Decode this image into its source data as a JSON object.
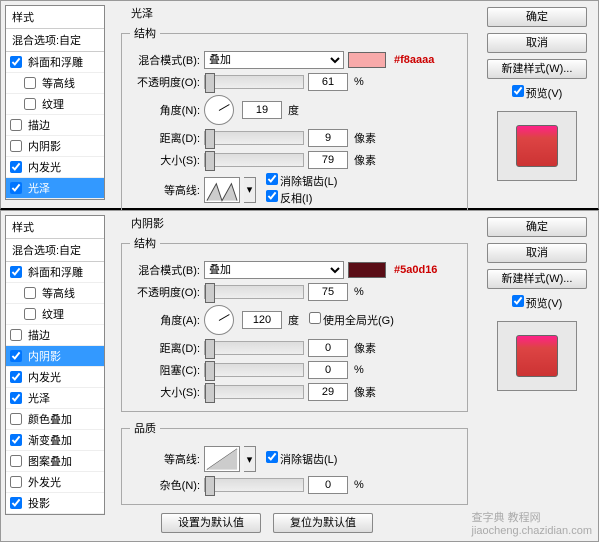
{
  "common": {
    "styles_header": "样式",
    "blend_options": "混合选项:自定",
    "ok": "确定",
    "cancel": "取消",
    "new_style": "新建样式(W)...",
    "preview": "预览(V)",
    "watermark": "查字典 教程网",
    "watermark_url": "jiaocheng.chazidian.com"
  },
  "p1": {
    "title": "光泽",
    "structure": "结构",
    "effects": {
      "bevel": "斜面和浮雕",
      "contour": "等高线",
      "texture": "纹理",
      "stroke": "描边",
      "inner_shadow": "内阴影",
      "inner_glow": "内发光",
      "satin": "光泽"
    },
    "fields": {
      "blend_mode_l": "混合模式(B):",
      "blend_mode_v": "叠加",
      "swatch": "#f8aaaa",
      "opacity_l": "不透明度(O):",
      "opacity_v": "61",
      "opacity_u": "%",
      "angle_l": "角度(N):",
      "angle_v": "19",
      "angle_u": "度",
      "distance_l": "距离(D):",
      "distance_v": "9",
      "distance_u": "像素",
      "size_l": "大小(S):",
      "size_v": "79",
      "size_u": "像素",
      "contour_l": "等高线:",
      "anti_l": "消除锯齿(L)",
      "invert_l": "反相(I)"
    }
  },
  "p2": {
    "title": "内阴影",
    "structure": "结构",
    "quality": "品质",
    "set_default": "设置为默认值",
    "reset_default": "复位为默认值",
    "effects": {
      "bevel": "斜面和浮雕",
      "contour": "等高线",
      "texture": "纹理",
      "stroke": "描边",
      "inner_shadow": "内阴影",
      "inner_glow": "内发光",
      "satin": "光泽",
      "color_overlay": "颜色叠加",
      "gradient_overlay": "渐变叠加",
      "pattern_overlay": "图案叠加",
      "outer_glow": "外发光",
      "drop_shadow": "投影"
    },
    "fields": {
      "blend_mode_l": "混合模式(B):",
      "blend_mode_v": "叠加",
      "swatch": "#5a0d16",
      "opacity_l": "不透明度(O):",
      "opacity_v": "75",
      "opacity_u": "%",
      "angle_l": "角度(A):",
      "angle_v": "120",
      "angle_u": "度",
      "global_l": "使用全局光(G)",
      "distance_l": "距离(D):",
      "distance_v": "0",
      "distance_u": "像素",
      "choke_l": "阻塞(C):",
      "choke_v": "0",
      "choke_u": "%",
      "size_l": "大小(S):",
      "size_v": "29",
      "size_u": "像素",
      "contour_l": "等高线:",
      "anti_l": "消除锯齿(L)",
      "noise_l": "杂色(N):",
      "noise_v": "0",
      "noise_u": "%"
    }
  }
}
